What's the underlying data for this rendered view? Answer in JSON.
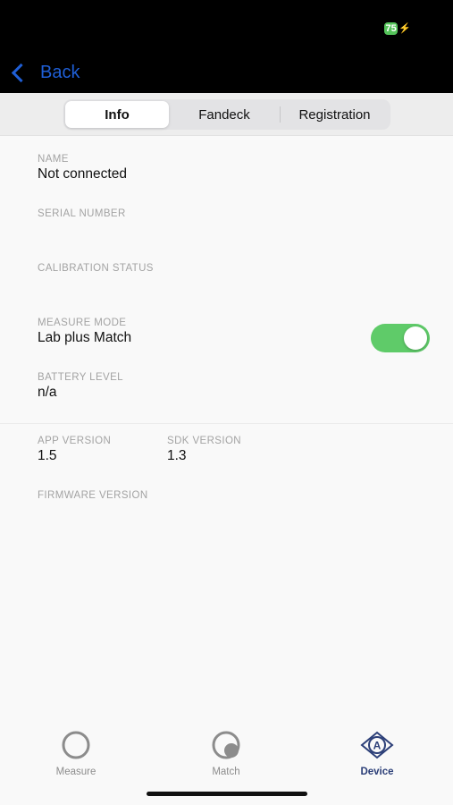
{
  "status_bar": {
    "battery_level": "75"
  },
  "nav": {
    "back_label": "Back"
  },
  "segments": {
    "items": [
      "Info",
      "Fandeck",
      "Registration"
    ],
    "selected": "Info"
  },
  "device_info": {
    "name_label": "NAME",
    "name_value": "Not connected",
    "serial_label": "SERIAL NUMBER",
    "serial_value": "",
    "calibration_label": "CALIBRATION STATUS",
    "calibration_value": "",
    "measure_mode_label": "MEASURE MODE",
    "measure_mode_value": "Lab plus Match",
    "measure_mode_toggle_on": true,
    "battery_label": "BATTERY LEVEL",
    "battery_value": "n/a"
  },
  "versions": {
    "app_label": "APP VERSION",
    "app_value": "1.5",
    "sdk_label": "SDK VERSION",
    "sdk_value": "1.3",
    "firmware_label": "FIRMWARE VERSION",
    "firmware_value": ""
  },
  "tabbar": {
    "items": [
      {
        "label": "Measure",
        "icon": "measure-icon"
      },
      {
        "label": "Match",
        "icon": "match-icon"
      },
      {
        "label": "Device",
        "icon": "device-icon"
      }
    ],
    "active": "Device"
  },
  "colors": {
    "accent": "#1f5fd6",
    "toggle_on": "#5fcb69",
    "active_tab": "#2c3f78",
    "battery": "#54c35a"
  }
}
